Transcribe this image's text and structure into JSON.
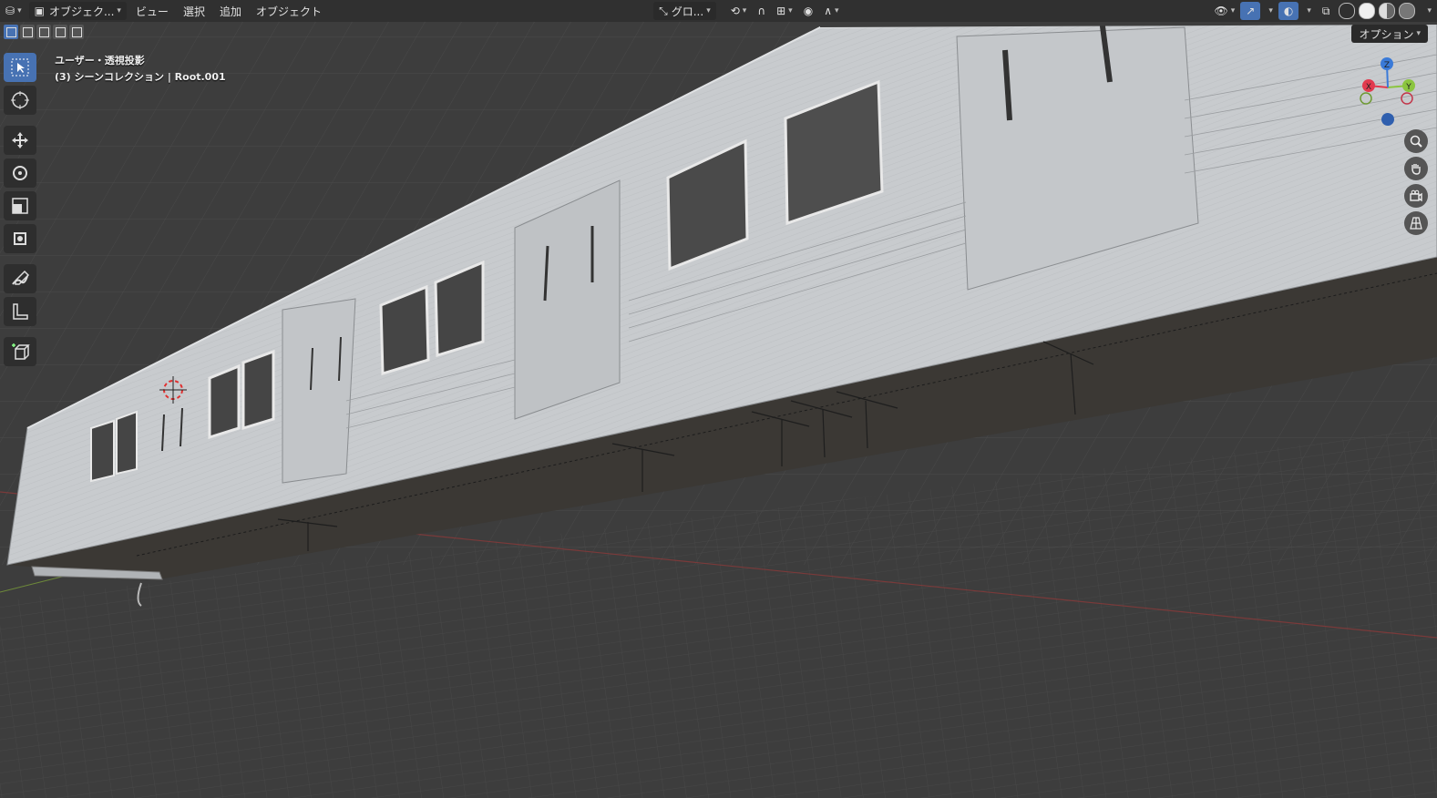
{
  "header": {
    "editor_type_icon": "3d-viewport-icon",
    "mode_label": "オブジェク...",
    "menus": [
      "ビュー",
      "選択",
      "追加",
      "オブジェクト"
    ],
    "transform_orientation": "グロ...",
    "options_label": "オプション"
  },
  "viewport": {
    "view_name": "ユーザー・透視投影",
    "collection_info": "(3) シーンコレクション | Root.001"
  },
  "gizmo": {
    "x_label": "X",
    "y_label": "Y",
    "z_label": "Z"
  },
  "colors": {
    "header_bg": "#303030",
    "viewport_bg": "#3d3d3d",
    "accent": "#4772b3",
    "axis_x": "#e23a4e",
    "axis_y": "#8bc53f",
    "axis_z": "#3a7ad8"
  },
  "toolbar_icons": [
    "select-box-icon",
    "cursor-icon",
    "move-icon",
    "rotate-icon",
    "scale-icon",
    "transform-icon",
    "annotate-icon",
    "measure-icon",
    "add-cube-icon"
  ]
}
